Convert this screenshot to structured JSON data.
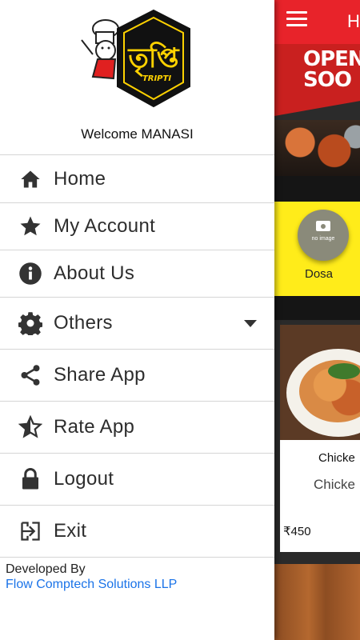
{
  "drawer": {
    "logo_text": "TRIPTI",
    "welcome_text": "Welcome MANASI",
    "menu": [
      {
        "label": "Home",
        "icon": "home-icon"
      },
      {
        "label": "My Account",
        "icon": "star-icon"
      },
      {
        "label": "About Us",
        "icon": "info-icon"
      },
      {
        "label": "Others",
        "icon": "gear-icon"
      },
      {
        "label": "Share App",
        "icon": "share-icon"
      },
      {
        "label": "Rate App",
        "icon": "star-half-icon"
      },
      {
        "label": "Logout",
        "icon": "lock-icon"
      },
      {
        "label": "Exit",
        "icon": "exit-icon"
      }
    ],
    "footer": {
      "developed_by": "Developed By",
      "company": "Flow Comptech Solutions LLP"
    }
  },
  "background": {
    "app_title": "H",
    "banner_text_line1": "OPEN",
    "banner_text_line2": "SOO",
    "category_label": "Dosa",
    "no_image_label": "no image",
    "card_title": "Chicke",
    "card_subtitle": "Chicke",
    "card_price": "₹450"
  },
  "colors": {
    "appbar": "#e8232a",
    "category_bg": "#ffec1a",
    "link": "#1a73e8"
  }
}
